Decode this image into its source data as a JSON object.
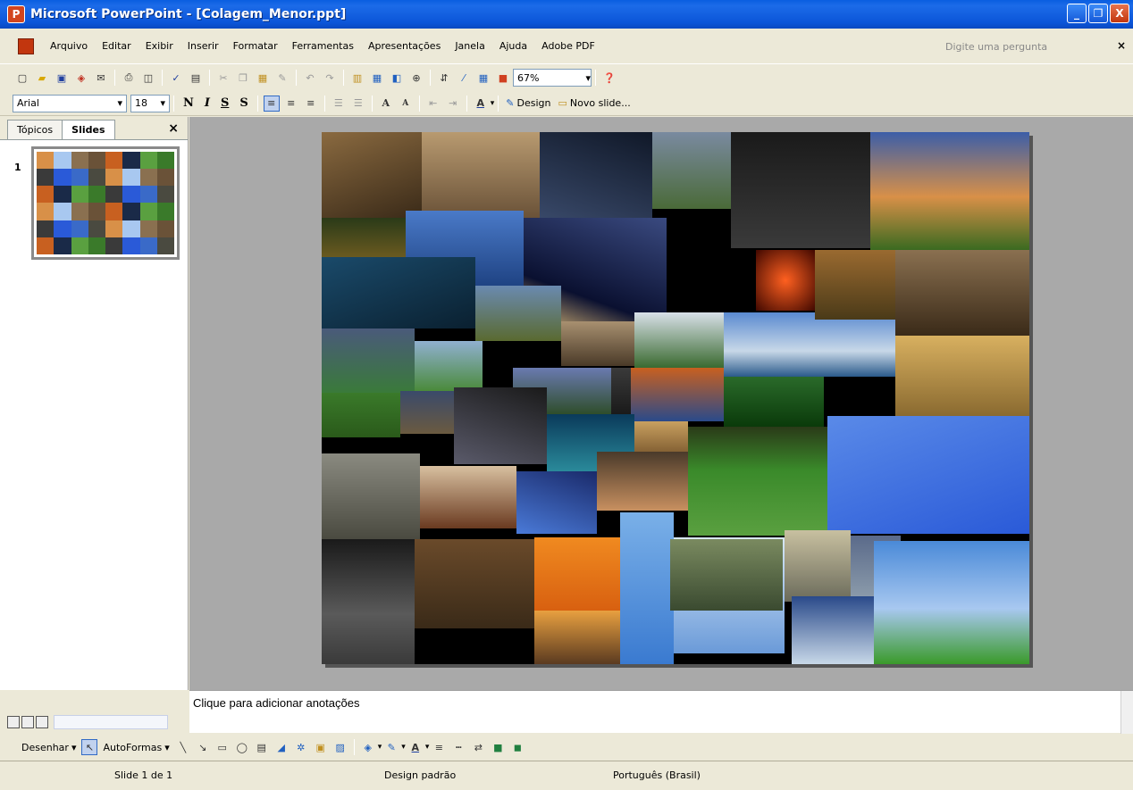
{
  "window": {
    "title": "Microsoft PowerPoint - [Colagem_Menor.ppt]",
    "controls": [
      "_",
      "❐",
      "X"
    ]
  },
  "menubar": {
    "items": [
      "Arquivo",
      "Editar",
      "Exibir",
      "Inserir",
      "Formatar",
      "Ferramentas",
      "Apresentações",
      "Janela",
      "Ajuda",
      "Adobe PDF"
    ],
    "help_placeholder": "Digite uma pergunta",
    "close": "×"
  },
  "standard_toolbar": {
    "zoom": "67%"
  },
  "format_toolbar": {
    "font": "Arial",
    "size": "18",
    "bold": "N",
    "italic": "I",
    "underline": "S",
    "shadow": "S",
    "design_label": "Design",
    "new_slide_label": "Novo slide..."
  },
  "left_panel": {
    "tabs": [
      "Tópicos",
      "Slides"
    ],
    "active_tab": "Slides",
    "close": "×",
    "slide_number": "1"
  },
  "notes": {
    "placeholder": "Clique para adicionar anotações"
  },
  "drawing_toolbar": {
    "draw_label": "Desenhar",
    "autoshapes_label": "AutoFormas"
  },
  "statusbar": {
    "slide": "Slide 1 de 1",
    "design": "Design padrão",
    "language": "Português (Brasil)"
  },
  "colors": {
    "titlebar": "#0A5EE0",
    "chrome": "#ECE9D8",
    "canvas": "#A9A9A9"
  }
}
